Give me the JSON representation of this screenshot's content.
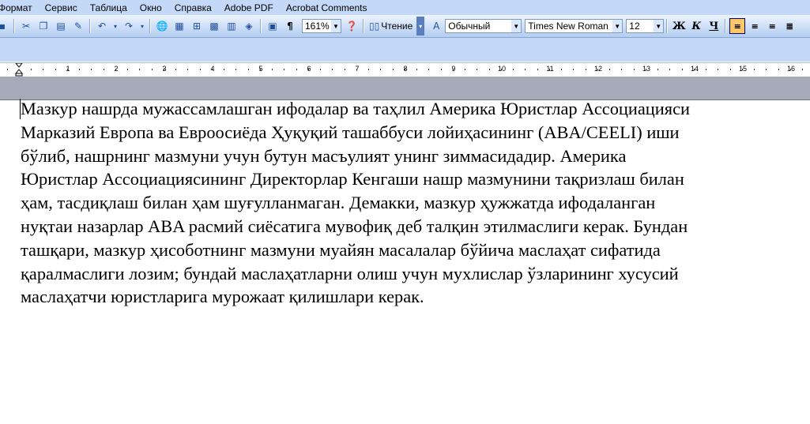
{
  "menu": [
    "Формат",
    "Сервис",
    "Таблица",
    "Окно",
    "Справка",
    "Adobe PDF",
    "Acrobat Comments"
  ],
  "toolbar": {
    "zoom": "161%",
    "reading_label": "Чтение",
    "style": "Обычный",
    "font": "Times New Roman",
    "size": "12",
    "bold_label": "Ж",
    "italic_label": "К",
    "underline_label": "Ч"
  },
  "ruler": {
    "numbers": [
      "1",
      "2",
      "3",
      "4",
      "5",
      "6",
      "7",
      "8",
      "9",
      "10",
      "11",
      "12",
      "13",
      "14",
      "15",
      "16"
    ]
  },
  "document": {
    "lines": [
      "Мазкур нашрда мужассамлашган ифодалар ва таҳлил Америка Юристлар Ассоциацияси",
      "Марказий Европа ва Евроосиёда Ҳуқуқий ташаббуси лойиҳасининг (ABA/CEELI) иши",
      "бўлиб, нашрнинг мазмуни учун бутун масъулият унинг зиммасидадир. Америка",
      "Юристлар Ассоциациясининг Директорлар Кенгаши нашр мазмунини тақризлаш билан",
      "ҳам, тасдиқлаш билан ҳам шуғулланмаган. Демакки, мазкур ҳужжатда ифодаланган",
      "нуқтаи назарлар ABA расмий сиёсатига мувофиқ деб талқин этилмаслиги керак. Бундан",
      "ташқари, мазкур ҳисоботнинг мазмуни муайян масалалар бўйича маслаҳат сифатида",
      "қаралмаслиги лозим; бундай маслаҳатларни олиш учун мухлислар ўзларининг хусусий",
      "маслаҳатчи юристларига мурожаат қилишлари керак."
    ]
  }
}
